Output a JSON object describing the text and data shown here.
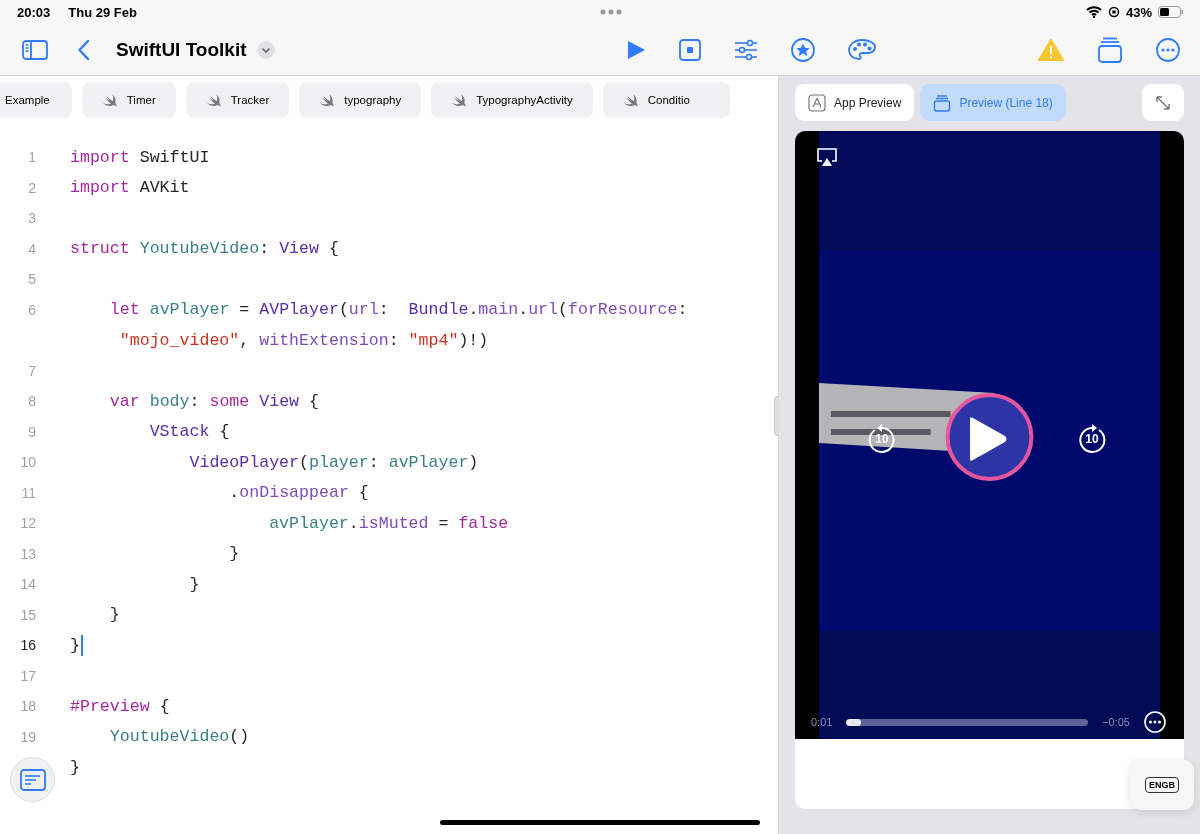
{
  "status_bar": {
    "time": "20:03",
    "date": "Thu 29 Feb",
    "battery": "43%"
  },
  "toolbar": {
    "title": "SwiftUI Toolkit"
  },
  "file_tabs": [
    {
      "label": "Example",
      "icon": false,
      "selected": false
    },
    {
      "label": "Timer",
      "icon": true,
      "selected": false
    },
    {
      "label": "Tracker",
      "icon": true,
      "selected": false
    },
    {
      "label": "typography",
      "icon": true,
      "selected": false
    },
    {
      "label": "TypographyActivity",
      "icon": true,
      "selected": false
    },
    {
      "label": "Conditio",
      "icon": true,
      "selected": false
    }
  ],
  "editor": {
    "lines": [
      {
        "number": "1",
        "current": false,
        "segments": [
          {
            "kind": "kw",
            "t": "import"
          },
          {
            "kind": "plain",
            "t": " SwiftUI"
          }
        ]
      },
      {
        "number": "2",
        "current": false,
        "segments": [
          {
            "kind": "kw",
            "t": "import"
          },
          {
            "kind": "plain",
            "t": " AVKit"
          }
        ]
      },
      {
        "number": "3",
        "current": false
      },
      {
        "number": "4",
        "current": false,
        "segments": [
          {
            "kind": "kw",
            "t": "struct"
          },
          {
            "kind": "decl",
            "t": " YoutubeVideo"
          },
          {
            "kind": "plain",
            "t": ":"
          },
          {
            "kind": "type",
            "t": " View"
          },
          {
            "kind": "plain",
            "t": " {"
          }
        ]
      },
      {
        "number": "5",
        "current": false
      },
      {
        "number": "6",
        "current": false,
        "segments": [
          {
            "kind": "kw",
            "t": "    let"
          },
          {
            "kind": "decl",
            "t": " avPlayer"
          },
          {
            "kind": "plain",
            "t": " ="
          },
          {
            "kind": "type",
            "t": " AVPlayer"
          },
          {
            "kind": "plain",
            "t": "("
          },
          {
            "kind": "member",
            "t": "url"
          },
          {
            "kind": "plain",
            "t": ":"
          },
          {
            "kind": "type",
            "t": "  Bundle"
          },
          {
            "kind": "plain",
            "t": "."
          },
          {
            "kind": "member",
            "t": "main"
          },
          {
            "kind": "plain",
            "t": "."
          },
          {
            "kind": "member",
            "t": "url"
          },
          {
            "kind": "plain",
            "t": "("
          },
          {
            "kind": "member",
            "t": "forResource"
          },
          {
            "kind": "plain",
            "t": ":"
          }
        ]
      },
      {
        "current": false,
        "segments": [
          {
            "kind": "str",
            "t": "     \"mojo_video\""
          },
          {
            "kind": "plain",
            "t": ","
          },
          {
            "kind": "member",
            "t": " withExtension"
          },
          {
            "kind": "plain",
            "t": ":"
          },
          {
            "kind": "str",
            "t": " \"mp4\""
          },
          {
            "kind": "plain",
            "t": ")!)"
          }
        ]
      },
      {
        "number": "7",
        "current": false
      },
      {
        "number": "8",
        "current": false,
        "segments": [
          {
            "kind": "kw",
            "t": "    var"
          },
          {
            "kind": "decl",
            "t": " body"
          },
          {
            "kind": "plain",
            "t": ":"
          },
          {
            "kind": "kw",
            "t": " some"
          },
          {
            "kind": "type",
            "t": " View"
          },
          {
            "kind": "plain",
            "t": " {"
          }
        ]
      },
      {
        "number": "9",
        "current": false,
        "segments": [
          {
            "kind": "type",
            "t": "        VStack"
          },
          {
            "kind": "plain",
            "t": " {"
          }
        ]
      },
      {
        "number": "10",
        "current": false,
        "segments": [
          {
            "kind": "type",
            "t": "            VideoPlayer"
          },
          {
            "kind": "plain",
            "t": "("
          },
          {
            "kind": "decl",
            "t": "player"
          },
          {
            "kind": "plain",
            "t": ":"
          },
          {
            "kind": "decl",
            "t": " avPlayer"
          },
          {
            "kind": "plain",
            "t": ")"
          }
        ]
      },
      {
        "number": "11",
        "current": false,
        "segments": [
          {
            "kind": "plain",
            "t": "                ."
          },
          {
            "kind": "member",
            "t": "onDisappear"
          },
          {
            "kind": "plain",
            "t": " {"
          }
        ]
      },
      {
        "number": "12",
        "current": false,
        "segments": [
          {
            "kind": "decl",
            "t": "                    avPlayer"
          },
          {
            "kind": "plain",
            "t": "."
          },
          {
            "kind": "member",
            "t": "isMuted"
          },
          {
            "kind": "plain",
            "t": " ="
          },
          {
            "kind": "kw",
            "t": " false"
          }
        ]
      },
      {
        "number": "13",
        "current": false,
        "segments": [
          {
            "kind": "plain",
            "t": "                }"
          }
        ]
      },
      {
        "number": "14",
        "current": false,
        "segments": [
          {
            "kind": "plain",
            "t": "            }"
          }
        ]
      },
      {
        "number": "15",
        "current": false,
        "segments": [
          {
            "kind": "plain",
            "t": "    }"
          }
        ]
      },
      {
        "number": "16",
        "current": true,
        "segments": [
          {
            "kind": "plain",
            "t": "}"
          }
        ]
      },
      {
        "number": "17",
        "current": false
      },
      {
        "number": "18",
        "current": false,
        "segments": [
          {
            "kind": "kw",
            "t": "#Preview"
          },
          {
            "kind": "plain",
            "t": " {"
          }
        ]
      },
      {
        "number": "19",
        "current": false,
        "segments": [
          {
            "kind": "decl",
            "t": "    YoutubeVideo"
          },
          {
            "kind": "plain",
            "t": "()"
          }
        ]
      },
      {
        "current": false,
        "segments": [
          {
            "kind": "plain",
            "t": "}"
          }
        ]
      }
    ]
  },
  "preview": {
    "tabs": [
      {
        "label": "App Preview",
        "selected": false
      },
      {
        "label": "Preview (Line 18)",
        "selected": true
      }
    ],
    "player": {
      "kind": "picture",
      "skip_back": "10",
      "skip_forward": "10",
      "elapsed": "0:01",
      "remaining": "−0:05",
      "level": 0.06
    },
    "keyboard_key": "ENGB"
  }
}
